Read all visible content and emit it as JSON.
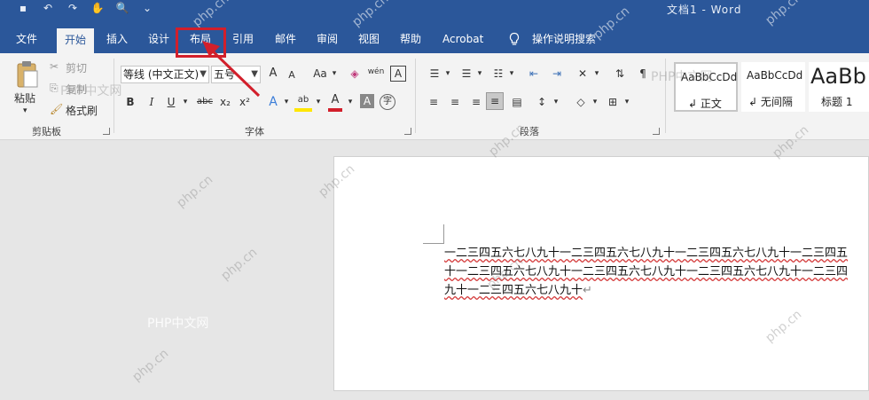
{
  "window": {
    "title": "文档1  -  Word"
  },
  "tabs": [
    "文件",
    "开始",
    "插入",
    "设计",
    "布局",
    "引用",
    "邮件",
    "审阅",
    "视图",
    "帮助",
    "Acrobat"
  ],
  "active_tab": "开始",
  "tell_me": "操作说明搜索",
  "clipboard": {
    "paste": "粘贴",
    "cut": "剪切",
    "copy": "复制",
    "format_painter": "格式刷",
    "label": "剪贴板"
  },
  "font": {
    "family": "等线 (中文正文)",
    "size": "五号",
    "grow": "A",
    "shrink": "A",
    "case": "Aa",
    "pinyin": "wén",
    "bold": "B",
    "italic": "I",
    "underline": "U",
    "strike": "abc",
    "sub": "x₂",
    "sup": "x²",
    "effects": "A",
    "highlight": "ab",
    "color": "A",
    "shade": "A",
    "enclose": "字",
    "label": "字体"
  },
  "paragraph": {
    "label": "段落"
  },
  "styles": [
    {
      "sample": "AaBbCcDd",
      "name": "正文"
    },
    {
      "sample": "AaBbCcDd",
      "name": "无间隔"
    },
    {
      "sample": "AaBb",
      "name": "标题 1"
    }
  ],
  "document": {
    "lines": [
      "一二三四五六七八九十一二三四五六七八九十一二三四五六七八九十一二三四五",
      "十一二三四五六七八九十一二三四五六七八九十一二三四五六七八九十一二三四",
      "九十一二三四五六七八九十"
    ]
  },
  "watermarks": [
    "php.cn",
    "PHP中文网"
  ],
  "colors": {
    "accent": "#2b579a",
    "annotation": "#d21f2b"
  }
}
